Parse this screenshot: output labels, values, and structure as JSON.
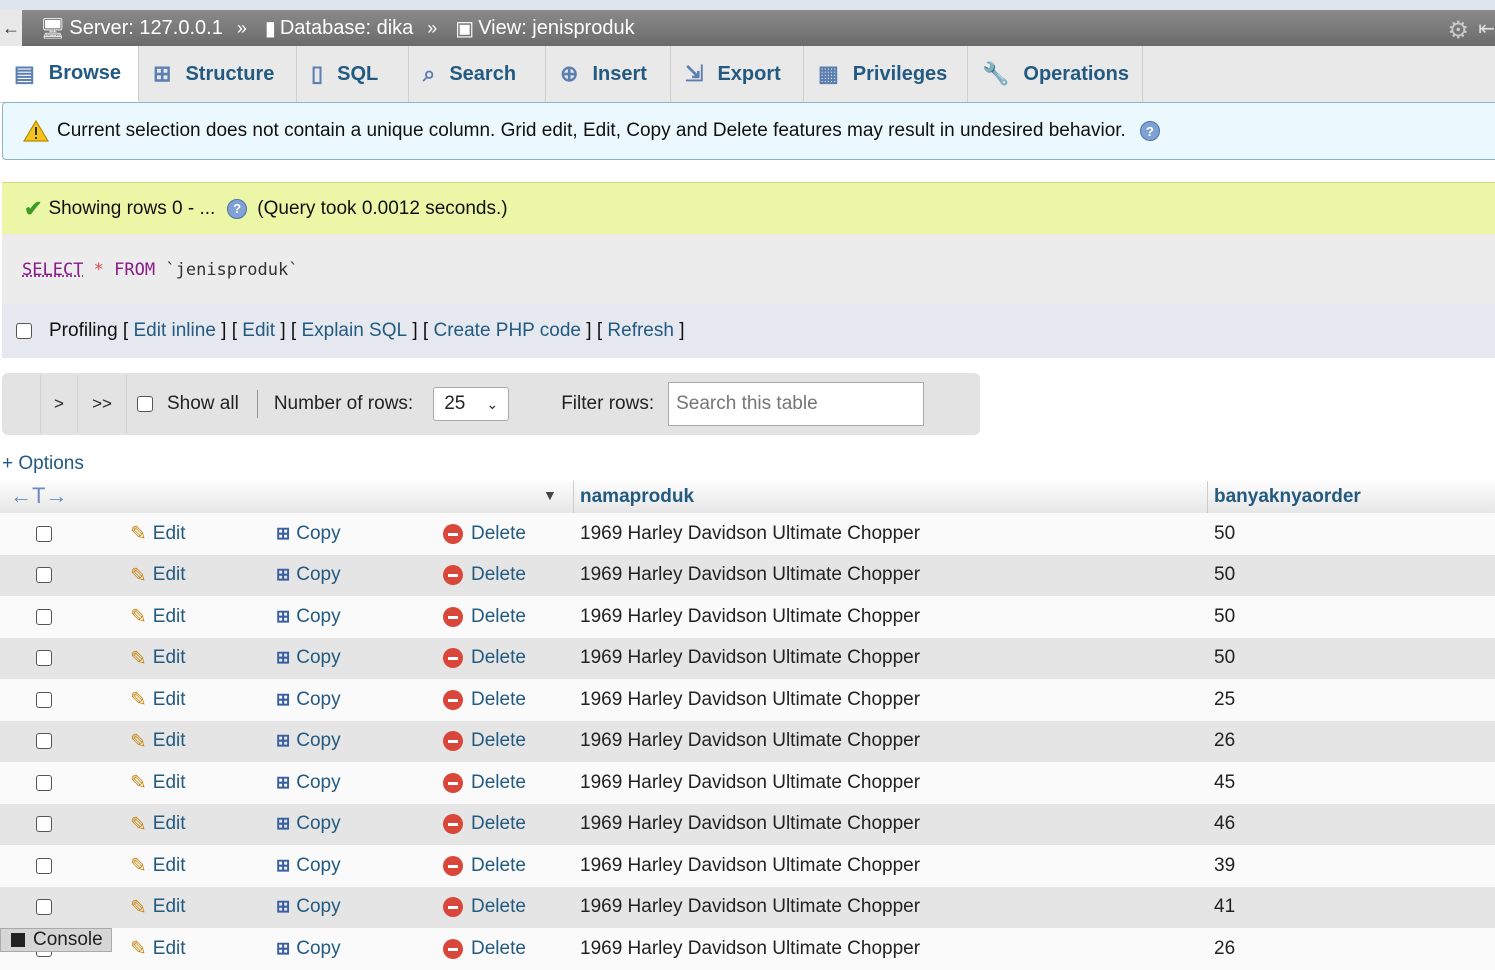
{
  "breadcrumb": {
    "server": "Server: 127.0.0.1",
    "database": "Database: dika",
    "view": "View: jenisproduk",
    "separator": "»"
  },
  "tabs": [
    {
      "label": "Browse",
      "icon": "browse-icon"
    },
    {
      "label": "Structure",
      "icon": "structure-icon"
    },
    {
      "label": "SQL",
      "icon": "sql-icon"
    },
    {
      "label": "Search",
      "icon": "search-icon"
    },
    {
      "label": "Insert",
      "icon": "insert-icon"
    },
    {
      "label": "Export",
      "icon": "export-icon"
    },
    {
      "label": "Privileges",
      "icon": "privileges-icon"
    },
    {
      "label": "Operations",
      "icon": "operations-icon"
    }
  ],
  "notice": {
    "text": "Current selection does not contain a unique column. Grid edit, Edit, Copy and Delete features may result in undesired behavior."
  },
  "success": {
    "showing": "Showing rows 0 - ...",
    "query_time": "(Query took 0.0012 seconds.)"
  },
  "sql": {
    "select": "SELECT",
    "star": "*",
    "from": "FROM",
    "table": "`jenisproduk`"
  },
  "profiling": {
    "label": "Profiling",
    "links": [
      "Edit inline",
      "Edit",
      "Explain SQL",
      "Create PHP code",
      "Refresh"
    ]
  },
  "nav": {
    "next": ">",
    "last": ">>",
    "show_all": "Show all",
    "rows_label": "Number of rows:",
    "rows_value": "25",
    "filter_label": "Filter rows:",
    "filter_placeholder": "Search this table"
  },
  "options_link": "+ Options",
  "table": {
    "columns": [
      "namaproduk",
      "banyaknyaorder"
    ],
    "action_labels": {
      "edit": "Edit",
      "copy": "Copy",
      "delete": "Delete"
    },
    "rows": [
      {
        "namaproduk": "1969 Harley Davidson Ultimate Chopper",
        "banyaknyaorder": "50"
      },
      {
        "namaproduk": "1969 Harley Davidson Ultimate Chopper",
        "banyaknyaorder": "50"
      },
      {
        "namaproduk": "1969 Harley Davidson Ultimate Chopper",
        "banyaknyaorder": "50"
      },
      {
        "namaproduk": "1969 Harley Davidson Ultimate Chopper",
        "banyaknyaorder": "50"
      },
      {
        "namaproduk": "1969 Harley Davidson Ultimate Chopper",
        "banyaknyaorder": "25"
      },
      {
        "namaproduk": "1969 Harley Davidson Ultimate Chopper",
        "banyaknyaorder": "26"
      },
      {
        "namaproduk": "1969 Harley Davidson Ultimate Chopper",
        "banyaknyaorder": "45"
      },
      {
        "namaproduk": "1969 Harley Davidson Ultimate Chopper",
        "banyaknyaorder": "46"
      },
      {
        "namaproduk": "1969 Harley Davidson Ultimate Chopper",
        "banyaknyaorder": "39"
      },
      {
        "namaproduk": "1969 Harley Davidson Ultimate Chopper",
        "banyaknyaorder": "41"
      },
      {
        "namaproduk": "1969 Harley Davidson Ultimate Chopper",
        "banyaknyaorder": "26"
      }
    ]
  },
  "console": {
    "label": "Console"
  },
  "colors": {
    "link": "#235a81",
    "success_bg": "#ebf7a6",
    "notice_bg": "#ebf8fd",
    "row_alt": "#e5e5e5"
  }
}
